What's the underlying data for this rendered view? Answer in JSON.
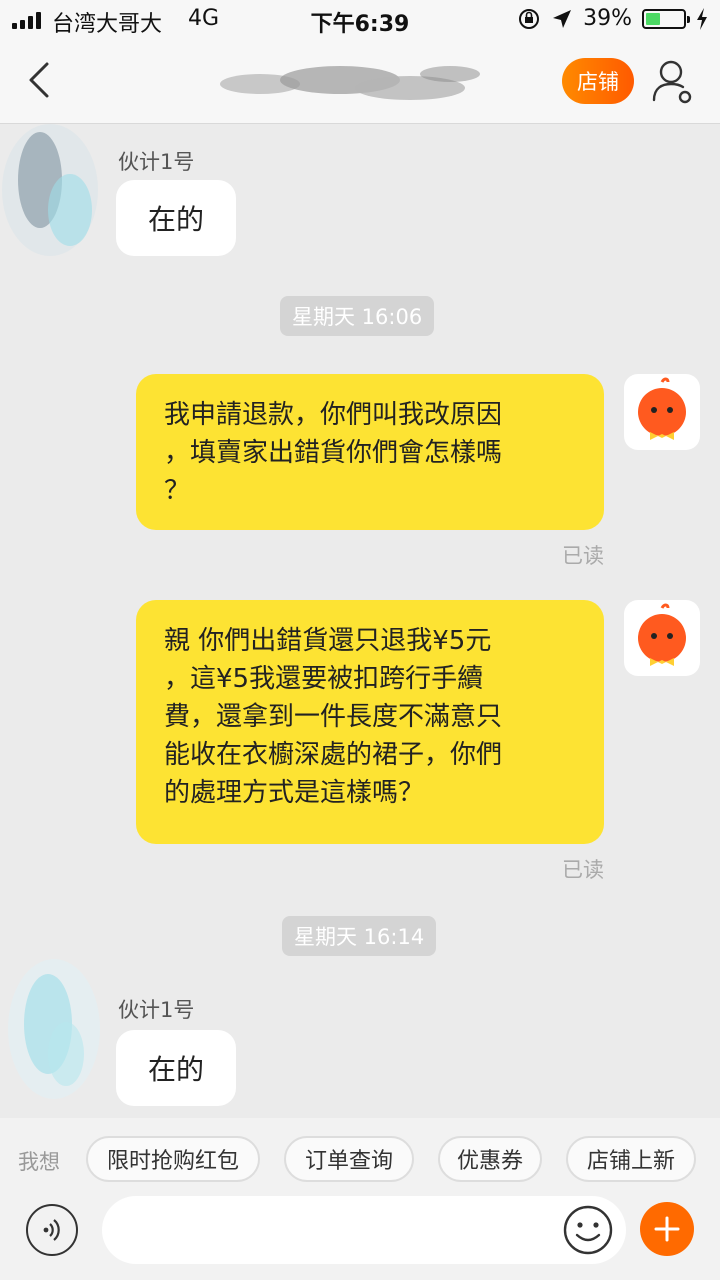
{
  "status_bar": {
    "carrier": "台湾大哥大",
    "network": "4G",
    "time": "下午6:39",
    "battery": "39%",
    "battery_level": 0.39
  },
  "nav": {
    "shop_label": "店铺"
  },
  "messages": [
    {
      "sender": "伙计1号",
      "text": "在的"
    },
    {
      "time": "星期天 16:06"
    },
    {
      "text": "我申請退款，你們叫我改原因，填賣家出錯貨你們會怎樣嗎？",
      "lines": [
        "我申請退款，你們叫我改原因",
        "，填賣家出錯貨你們會怎樣嗎",
        "？"
      ],
      "status": "已读"
    },
    {
      "text": "親 你們出錯貨還只退我¥5元，這¥5我還要被扣跨行手續費，還拿到一件長度不滿意只能收在衣櫥深處的裙子，你們的處理方式是這樣嗎？",
      "lines": [
        "親 你們出錯貨還只退我¥5元",
        "，這¥5我還要被扣跨行手續",
        "費，還拿到一件長度不滿意只",
        "能收在衣櫥深處的裙子，你們",
        "的處理方式是這樣嗎？"
      ],
      "status": "已读"
    },
    {
      "time": "星期天 16:14"
    },
    {
      "sender": "伙计1号",
      "text": "在的"
    }
  ],
  "quick_bar": {
    "label": "我想",
    "chips": [
      "限时抢购红包",
      "订单查询",
      "优惠券",
      "店铺上新"
    ]
  },
  "input": {
    "value": "",
    "placeholder": ""
  },
  "colors": {
    "accent": "#ff6a00",
    "my_bubble": "#fde333",
    "battery": "#4cd964"
  },
  "icons": [
    "back-arrow-icon",
    "user-settings-icon",
    "voice-icon",
    "emoji-icon",
    "plus-icon",
    "location-arrow-icon",
    "orientation-lock-icon",
    "charging-icon"
  ]
}
